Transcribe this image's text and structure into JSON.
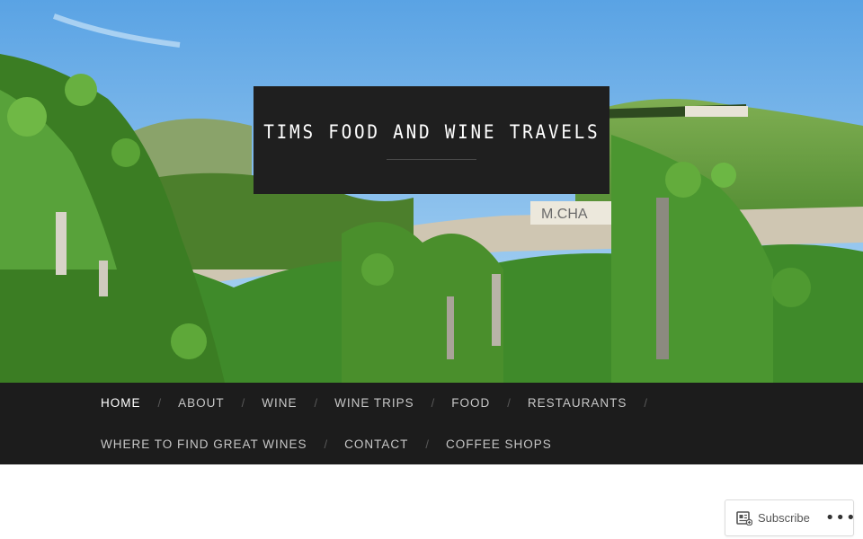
{
  "site": {
    "title": "TIMS FOOD AND WINE TRAVELS"
  },
  "hero": {
    "image": "vineyard-hillside-photo",
    "sign_text": "M.CHA"
  },
  "nav": {
    "items": [
      {
        "label": "HOME",
        "current": true
      },
      {
        "label": "ABOUT"
      },
      {
        "label": "WINE"
      },
      {
        "label": "WINE TRIPS"
      },
      {
        "label": "FOOD"
      },
      {
        "label": "RESTAURANTS"
      },
      {
        "label": "WHERE TO FIND GREAT WINES"
      },
      {
        "label": "CONTACT"
      },
      {
        "label": "COFFEE SHOPS"
      }
    ],
    "separator": "/"
  },
  "subscribe": {
    "label": "Subscribe",
    "icon": "reader-follow-icon",
    "more_icon": "more-dots-icon",
    "more_glyph": "•••"
  },
  "colors": {
    "nav_background": "#1c1c1c",
    "title_box": "#1f1f1f",
    "sky": "#8ec3ee",
    "foliage": "#3f8a2a"
  }
}
